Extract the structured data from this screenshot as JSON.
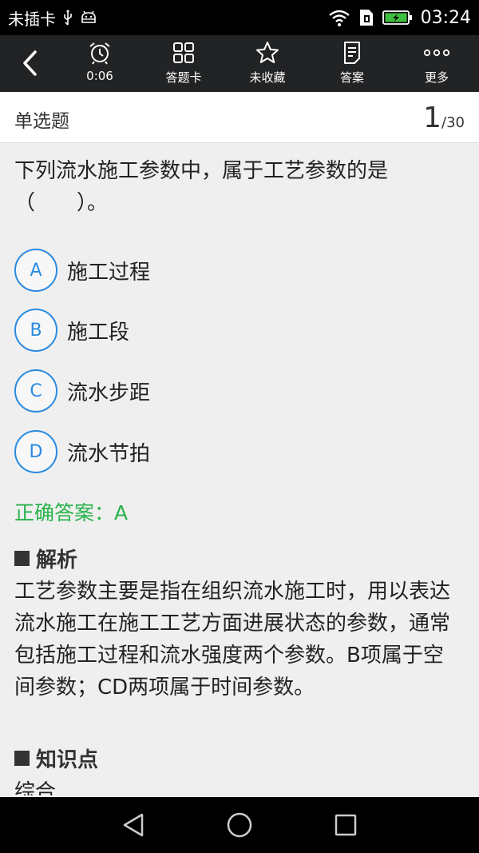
{
  "status_bar": {
    "carrier": "未插卡",
    "time": "03:24",
    "icons": [
      "usb-icon",
      "android-debug-icon",
      "wifi-icon",
      "sim-icon",
      "battery-charging-icon"
    ]
  },
  "toolbar": {
    "timer_label": "0:06",
    "answer_card_label": "答题卡",
    "favorite_label": "未收藏",
    "answer_label": "答案",
    "more_label": "更多"
  },
  "header": {
    "type": "单选题",
    "current": "1",
    "total": "/30"
  },
  "question": {
    "text": "下列流水施工参数中，属于工艺参数的是（　　）。",
    "options": [
      {
        "letter": "A",
        "text": "施工过程"
      },
      {
        "letter": "B",
        "text": "施工段"
      },
      {
        "letter": "C",
        "text": "流水步距"
      },
      {
        "letter": "D",
        "text": "流水节拍"
      }
    ],
    "correct_answer": "正确答案：A"
  },
  "analysis": {
    "title": "解析",
    "text": "工艺参数主要是指在组织流水施工时，用以表达流水施工在施工工艺方面进展状态的参数，通常包括施工过程和流水强度两个参数。B项属于空间参数；CD两项属于时间参数。"
  },
  "knowledge": {
    "title": "知识点",
    "text": "综合"
  },
  "colors": {
    "accent": "#2a8be0",
    "correct": "#27b24a",
    "toolbar_bg": "#222325"
  }
}
